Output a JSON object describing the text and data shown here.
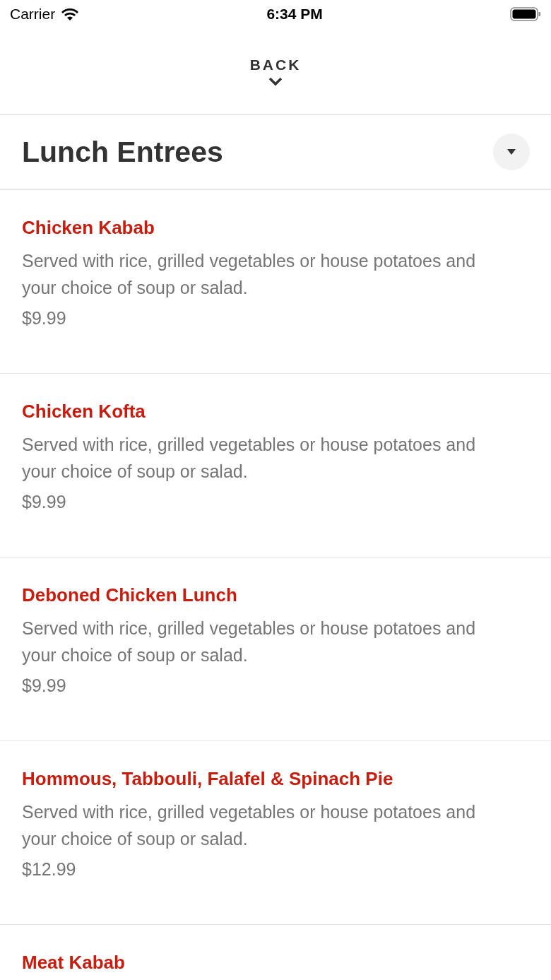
{
  "status_bar": {
    "carrier": "Carrier",
    "time": "6:34 PM"
  },
  "nav": {
    "back": "BACK"
  },
  "section": {
    "title": "Lunch Entrees",
    "expanded": true
  },
  "items": [
    {
      "name": "Chicken Kabab",
      "description": "Served with rice, grilled vegetables or house potatoes and your choice of soup or salad.",
      "price": "$9.99"
    },
    {
      "name": "Chicken Kofta",
      "description": "Served with rice, grilled vegetables or house potatoes and your choice of soup or salad.",
      "price": "$9.99"
    },
    {
      "name": "Deboned Chicken Lunch",
      "description": "Served with rice, grilled vegetables or house potatoes and your choice of soup or salad.",
      "price": "$9.99"
    },
    {
      "name": "Hommous, Tabbouli, Falafel & Spinach Pie",
      "description": "Served with rice, grilled vegetables or house potatoes and your choice of soup or salad.",
      "price": "$12.99"
    },
    {
      "name": "Meat Kabab"
    }
  ]
}
